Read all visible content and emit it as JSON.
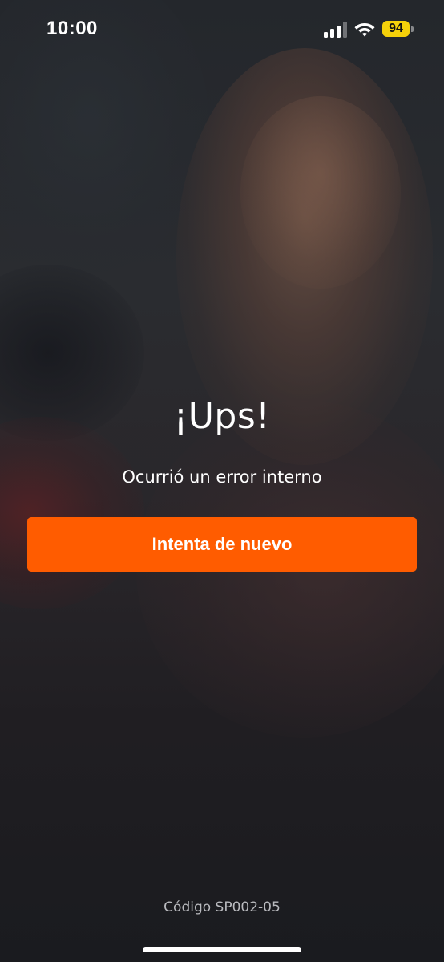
{
  "status_bar": {
    "time": "10:00",
    "battery_level": "94",
    "battery_color": "#f5d10a",
    "icons": [
      "cellular-signal-icon",
      "wifi-icon",
      "battery-icon"
    ]
  },
  "error": {
    "title": "¡Ups!",
    "message": "Ocurrió un error interno",
    "retry_label": "Intenta de nuevo",
    "code": "Código SP002-05"
  },
  "colors": {
    "accent": "#ff5c00",
    "text": "#ffffff",
    "muted_text": "#b9babe"
  }
}
